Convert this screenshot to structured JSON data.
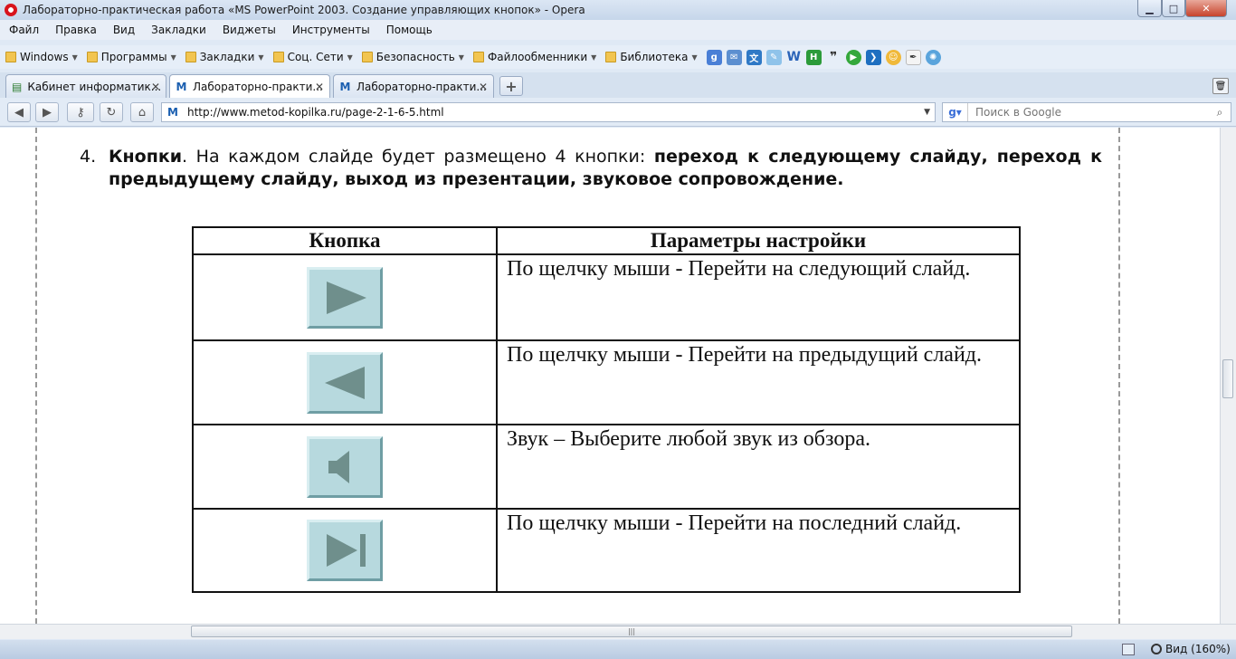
{
  "window": {
    "title": "Лабораторно-практическая работа «MS PowerPoint 2003. Создание управляющих кнопок» - Opera"
  },
  "menu": [
    "Файл",
    "Правка",
    "Вид",
    "Закладки",
    "Виджеты",
    "Инструменты",
    "Помощь"
  ],
  "bookmarks": [
    "Windows",
    "Программы",
    "Закладки",
    "Соц. Сети",
    "Безопасность",
    "Файлообменники",
    "Библиотека"
  ],
  "tabs": [
    {
      "label": "Кабинет информатик..."
    },
    {
      "label": "Лабораторно-практи..."
    },
    {
      "label": "Лабораторно-практи..."
    }
  ],
  "nav": {
    "url": "http://www.metod-kopilka.ru/page-2-1-6-5.html",
    "search_placeholder": "Поиск в Google"
  },
  "content": {
    "item_number": "4.",
    "lead": "Кнопки",
    "intro": ". На каждом слайде будет размещено 4 кнопки: ",
    "emphasis": "переход к следующему слайду, переход к предыдущему слайду, выход из презентации, звуковое сопровождение.",
    "table": {
      "headers": [
        "Кнопка",
        "Параметры настройки"
      ],
      "rows": [
        {
          "icon": "next-slide-icon",
          "text": "По щелчку мыши -  Перейти на следующий слайд."
        },
        {
          "icon": "previous-slide-icon",
          "text": "По щелчку мыши -  Перейти на предыдущий слайд."
        },
        {
          "icon": "sound-icon",
          "text": "Звук – Выберите любой звук из обзора."
        },
        {
          "icon": "last-slide-icon",
          "text": "По щелчку мыши -  Перейти на последний слайд."
        }
      ]
    }
  },
  "status": {
    "zoom_label": "Вид (160%)"
  },
  "colors": {
    "action_button_fill": "#b7d9de",
    "action_button_glyph": "#6f8f8c"
  }
}
